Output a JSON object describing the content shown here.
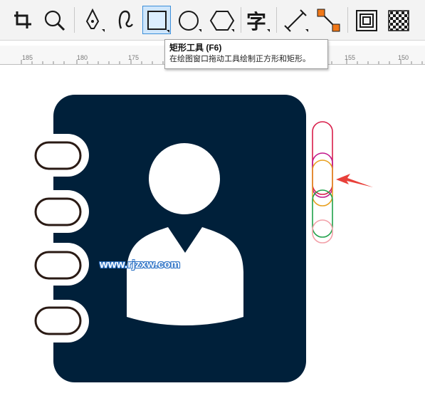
{
  "toolbar": {
    "tools": [
      {
        "name": "crop-tool",
        "icon": "crop-icon"
      },
      {
        "name": "zoom-tool",
        "icon": "magnifier-icon"
      },
      {
        "name": "pen-tool",
        "icon": "pen-nib-icon"
      },
      {
        "name": "artistic-media-tool",
        "icon": "curve-brush-icon"
      },
      {
        "name": "rectangle-tool",
        "icon": "rectangle-icon",
        "active": true
      },
      {
        "name": "ellipse-tool",
        "icon": "ellipse-icon"
      },
      {
        "name": "polygon-tool",
        "icon": "hexagon-icon"
      },
      {
        "name": "text-tool",
        "icon": "text-char-icon",
        "glyph": "字"
      },
      {
        "name": "dimension-tool",
        "icon": "dimension-line-icon"
      },
      {
        "name": "connector-tool",
        "icon": "connector-line-icon"
      },
      {
        "name": "contour-tool",
        "icon": "contour-icon"
      },
      {
        "name": "transparency-tool",
        "icon": "checkerboard-icon"
      }
    ]
  },
  "tooltip": {
    "title": "矩形工具 (F6)",
    "description": "在绘图窗口拖动工具绘制正方形和矩形。"
  },
  "ruler": {
    "labels": [
      "185",
      "180",
      "175",
      "155",
      "150"
    ]
  },
  "canvas": {
    "watermark": "www.rjzxw.com",
    "colors": {
      "notebook": "#00203a",
      "ring_outline": "#2a1a14",
      "arrow": "#e8403a",
      "outline_red": "#d81e4a",
      "outline_magenta": "#c2188c",
      "outline_orange": "#e8a020",
      "outline_green": "#1fa14a",
      "outline_pink": "#f2a0a8"
    }
  }
}
